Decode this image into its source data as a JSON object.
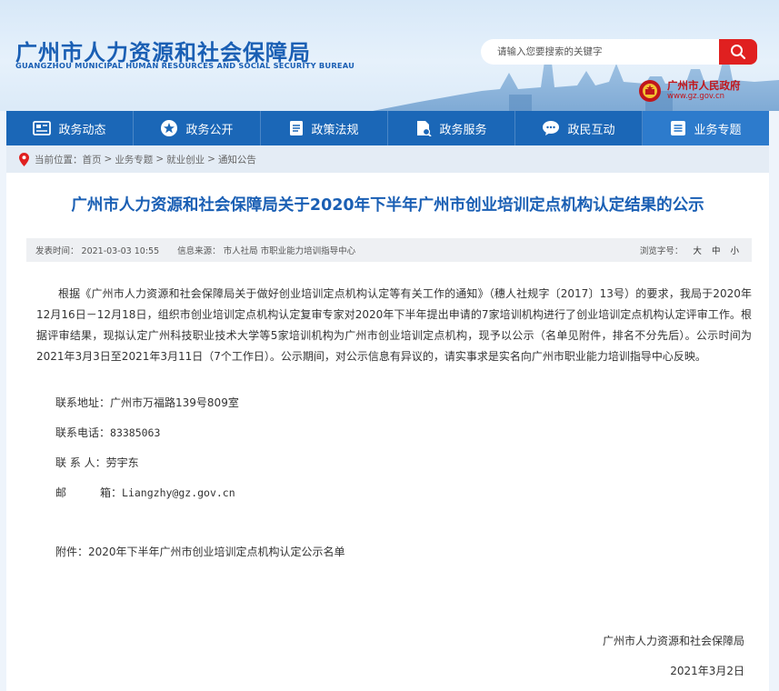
{
  "header": {
    "logo_cn": "广州市人力资源和社会保障局",
    "logo_en": "GUANGZHOU MUNICIPAL HUMAN RESOURCES AND SOCIAL SECURITY BUREAU",
    "search_placeholder": "请输入您要搜索的关键字",
    "gov_name": "广州市人民政府",
    "gov_url": "www.gz.gov.cn"
  },
  "nav": {
    "items": [
      {
        "label": "政务动态",
        "icon": "news-icon"
      },
      {
        "label": "政务公开",
        "icon": "star-icon"
      },
      {
        "label": "政策法规",
        "icon": "document-icon"
      },
      {
        "label": "政务服务",
        "icon": "service-icon"
      },
      {
        "label": "政民互动",
        "icon": "chat-icon"
      },
      {
        "label": "业务专题",
        "icon": "list-icon"
      }
    ]
  },
  "breadcrumb": {
    "prefix": "当前位置：",
    "items": [
      "首页",
      "业务专题",
      "就业创业",
      "通知公告"
    ],
    "sep": ">"
  },
  "article": {
    "title": "广州市人力资源和社会保障局关于2020年下半年广州市创业培训定点机构认定结果的公示",
    "publish_time": "发表时间： 2021-03-03 10:55",
    "source": "信息来源： 市人社局 市职业能力培训指导中心",
    "font_label": "浏览字号：",
    "font_large": "大",
    "font_medium": "中",
    "font_small": "小",
    "body": "根据《广州市人力资源和社会保障局关于做好创业培训定点机构认定等有关工作的通知》（穗人社规字〔2017〕13号）的要求，我局于2020年12月16日－12月18日，组织市创业培训定点机构认定复审专家对2020年下半年提出申请的7家培训机构进行了创业培训定点机构认定评审工作。根据评审结果，现拟认定广州科技职业技术大学等5家培训机构为广州市创业培训定点机构，现予以公示（名单见附件，排名不分先后）。公示时间为2021年3月3日至2021年3月11日（7个工作日）。公示期间，对公示信息有异议的，请实事求是实名向广州市职业能力培训指导中心反映。",
    "address_label": "联系地址：",
    "address": "广州市万福路139号809室",
    "phone_label": "联系电话：",
    "phone": "83385063",
    "person_label": "联 系 人：",
    "person": "劳宇东",
    "email_label_a": "邮",
    "email_label_b": "箱：",
    "email": "Liangzhy@gz.gov.cn",
    "attachment": "附件：2020年下半年广州市创业培训定点机构认定公示名单",
    "signer": "广州市人力资源和社会保障局",
    "date": "2021年3月2日"
  },
  "colors": {
    "brand_blue": "#1a5fb4",
    "nav_blue": "#1b67b7",
    "search_red": "#e02020",
    "gov_red": "#c0161c"
  }
}
